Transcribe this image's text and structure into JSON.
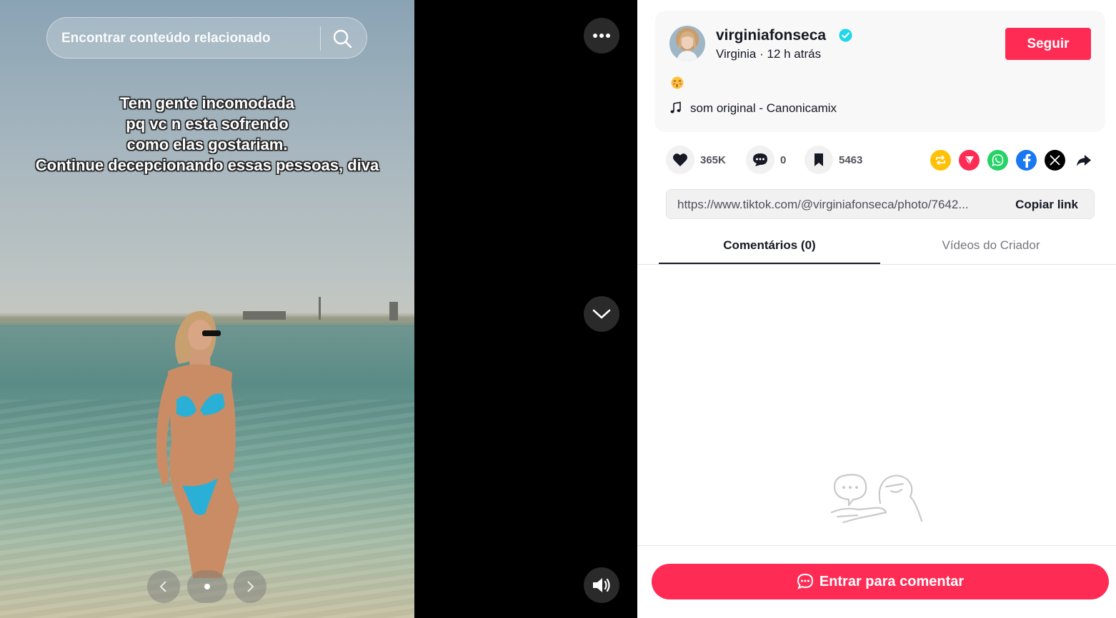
{
  "search": {
    "placeholder": "Encontrar conteúdo relacionado",
    "icon": "search-icon"
  },
  "photo": {
    "caption_lines": [
      "Tem gente incomodada",
      "pq vc n esta sofrendo",
      "como elas gostariam.",
      "Continue decepcionando essas pessoas, diva"
    ],
    "pager": {
      "prev_icon": "chevron-left-icon",
      "next_icon": "chevron-right-icon",
      "current": 1,
      "total": 1
    }
  },
  "controls": {
    "more_icon": "more-dots-icon",
    "next_video_icon": "chevron-down-icon",
    "volume_icon": "volume-icon"
  },
  "author": {
    "username": "virginiafonseca",
    "verified": true,
    "display_name": "Virginia",
    "separator": " · ",
    "posted_ago": "12 h atrás",
    "follow_label": "Seguir"
  },
  "post": {
    "emoji": "😚",
    "sound": "som original - Canonicamix"
  },
  "stats": {
    "likes": "365K",
    "comments": "0",
    "saves": "5463"
  },
  "share_targets": [
    "repost-icon",
    "send-to-friends-icon",
    "whatsapp-icon",
    "facebook-icon",
    "x-icon",
    "share-arrow-icon"
  ],
  "link": {
    "url": "https://www.tiktok.com/@virginiafonseca/photo/7642...",
    "copy_label": "Copiar link"
  },
  "tabs": [
    {
      "label": "Comentários (0)",
      "active": true
    },
    {
      "label": "Vídeos do Criador",
      "active": false
    }
  ],
  "comment_cta": "Entrar para comentar",
  "colors": {
    "accent": "#fe2c55",
    "verified": "#20d5ec",
    "text": "#161823"
  }
}
